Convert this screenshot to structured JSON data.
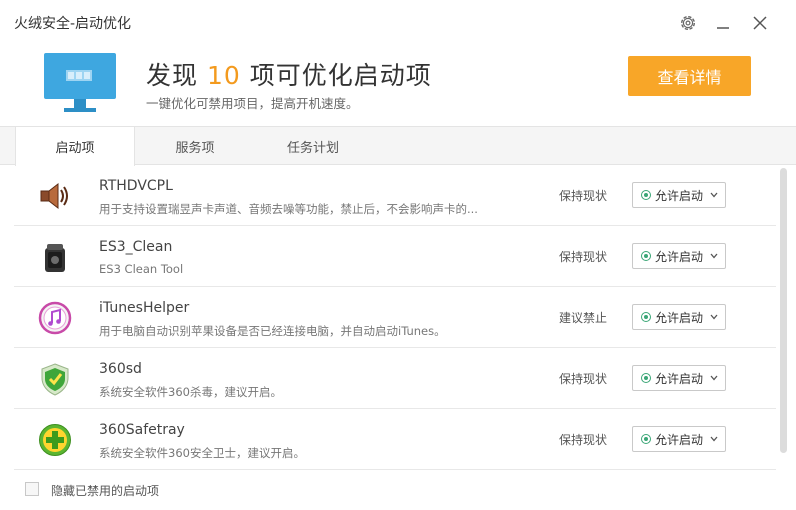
{
  "window": {
    "title": "火绒安全-启动优化"
  },
  "header": {
    "headline_prefix": "发现 ",
    "headline_count": "10",
    "headline_suffix": " 项可优化启动项",
    "subline": "一键优化可禁用项目，提高开机速度。",
    "detail_button": "查看详情",
    "accent_color": "#f8a628"
  },
  "tabs": [
    {
      "label": "启动项",
      "active": true
    },
    {
      "label": "服务项",
      "active": false
    },
    {
      "label": "任务计划",
      "active": false
    }
  ],
  "items": [
    {
      "name": "RTHDVCPL",
      "desc": "用于支持设置瑞昱声卡声道、音频去噪等功能，禁止后，不会影响声卡的...",
      "status": "保持现状",
      "select": "允许启动",
      "icon": "speaker-icon"
    },
    {
      "name": "ES3_Clean",
      "desc": "ES3 Clean Tool",
      "status": "保持现状",
      "select": "允许启动",
      "icon": "trash-can-icon"
    },
    {
      "name": "iTunesHelper",
      "desc": "用于电脑自动识别苹果设备是否已经连接电脑，并自动启动iTunes。",
      "status": "建议禁止",
      "select": "允许启动",
      "icon": "itunes-icon"
    },
    {
      "name": "360sd",
      "desc": "系统安全软件360杀毒，建议开启。",
      "status": "保持现状",
      "select": "允许启动",
      "icon": "shield-icon"
    },
    {
      "name": "360Safetray",
      "desc": "系统安全软件360安全卫士，建议开启。",
      "status": "保持现状",
      "select": "允许启动",
      "icon": "360-safeguard-icon"
    }
  ],
  "footer": {
    "hide_disabled_label": "隐藏已禁用的启动项"
  }
}
